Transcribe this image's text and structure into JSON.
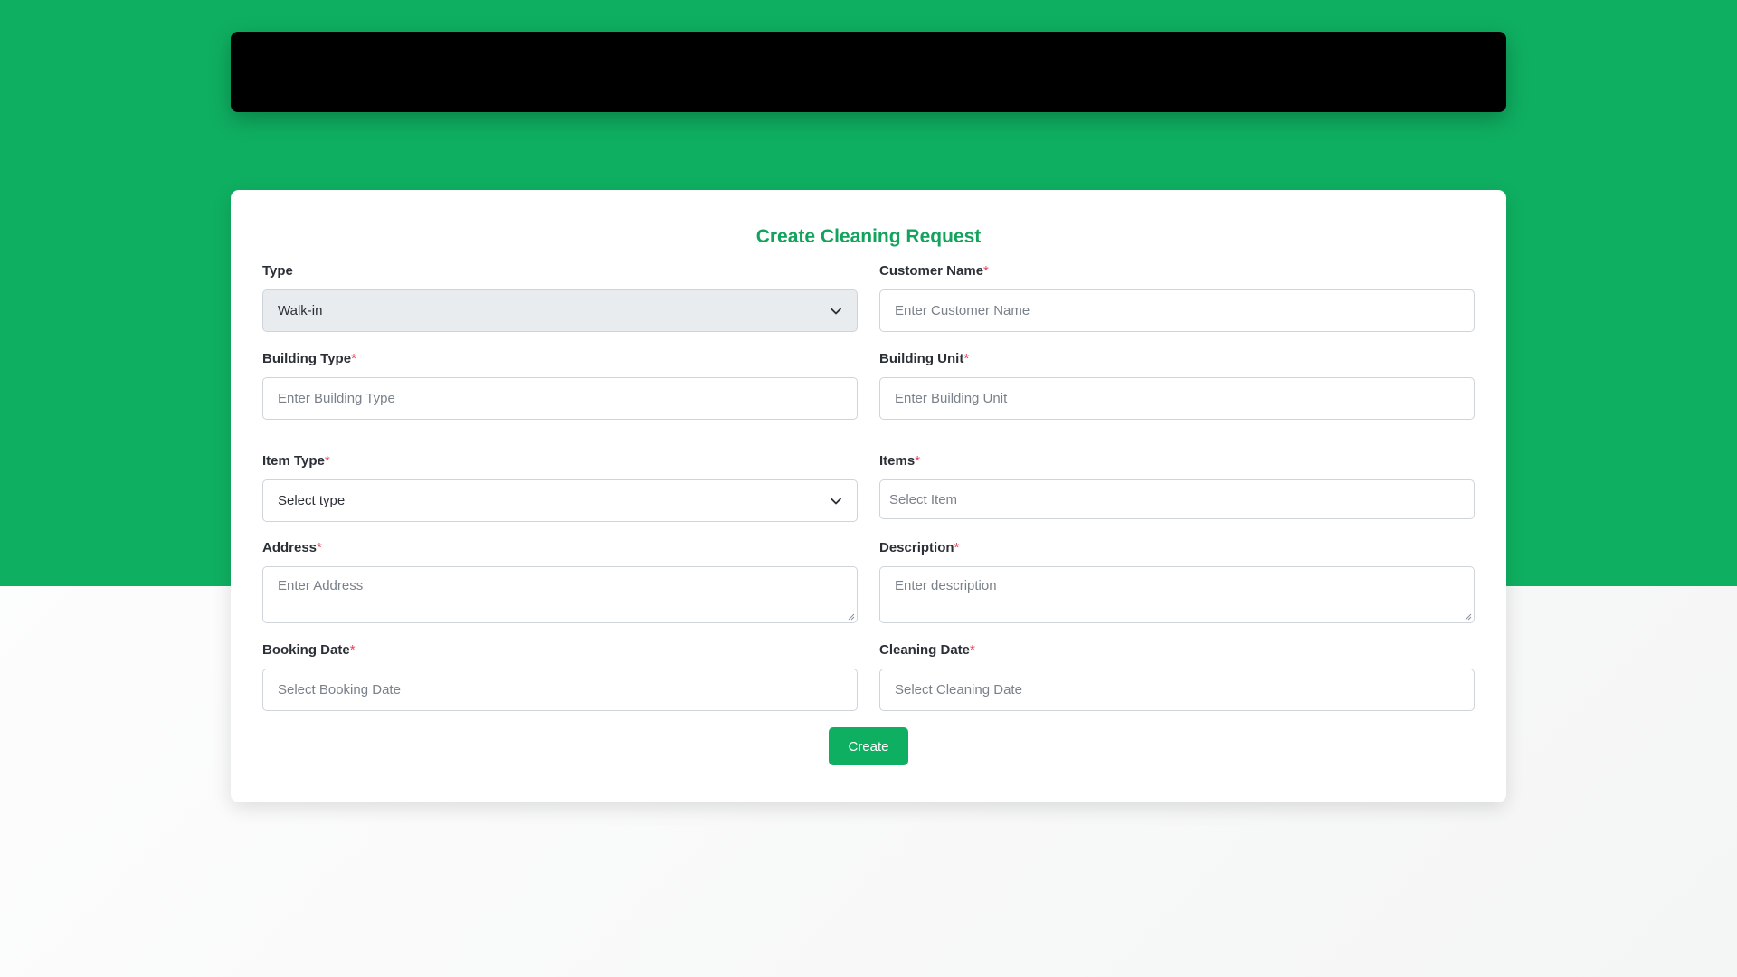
{
  "form": {
    "title": "Create Cleaning Request",
    "required_mark": "*",
    "type": {
      "label": "Type",
      "value": "Walk-in"
    },
    "customer_name": {
      "label": "Customer Name",
      "placeholder": "Enter Customer Name"
    },
    "building_type": {
      "label": "Building Type",
      "placeholder": "Enter Building Type"
    },
    "building_unit": {
      "label": "Building Unit",
      "placeholder": "Enter Building Unit"
    },
    "item_type": {
      "label": "Item Type",
      "value": "Select type"
    },
    "items": {
      "label": "Items",
      "placeholder": "Select Item"
    },
    "address": {
      "label": "Address",
      "placeholder": "Enter Address"
    },
    "description": {
      "label": "Description",
      "placeholder": "Enter description"
    },
    "booking_date": {
      "label": "Booking Date",
      "placeholder": "Select Booking Date"
    },
    "cleaning_date": {
      "label": "Cleaning Date",
      "placeholder": "Select Cleaning Date"
    },
    "submit_label": "Create"
  },
  "colors": {
    "brand_green": "#0faf61",
    "title_green": "#13a35c",
    "required_red": "#e0455b",
    "header_black": "#000000"
  },
  "icons": {
    "select_chevron": "chevron-down-icon",
    "textarea_resize": "resize-handle-icon"
  }
}
